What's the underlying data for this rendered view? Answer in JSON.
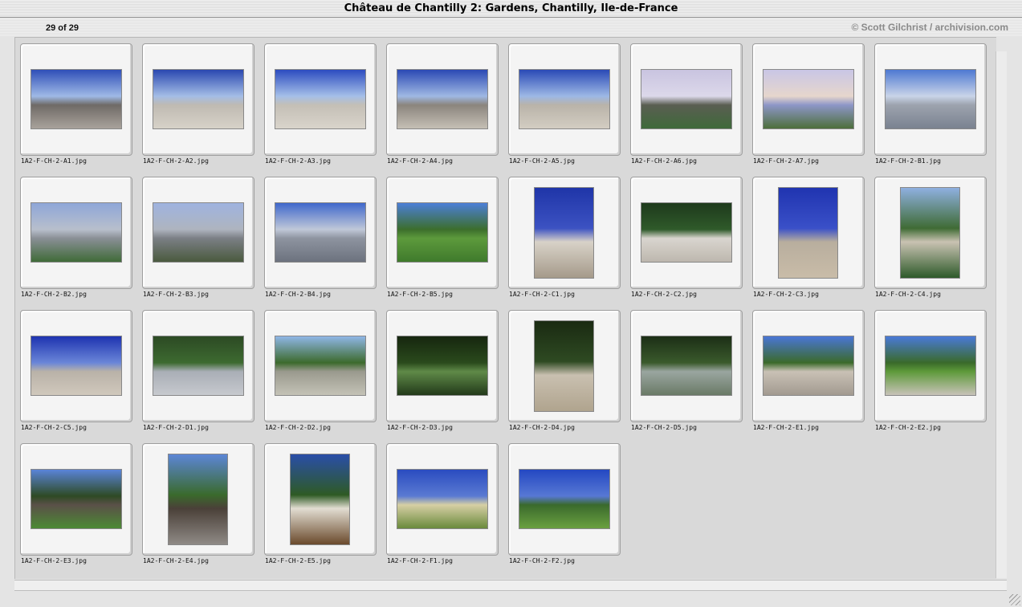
{
  "window": {
    "title": "Château de Chantilly 2: Gardens, Chantilly, Ile-de-France"
  },
  "header": {
    "counter": "29 of 29",
    "credit": "© Scott Gilchrist / archivision.com"
  },
  "thumbnails": [
    {
      "caption": "1A2-F-CH-2-A1.jpg",
      "orientation": "landscape",
      "colors": [
        "#2f4fb8",
        "#9fb9e6",
        "#6f6a66",
        "#a8a29b"
      ]
    },
    {
      "caption": "1A2-F-CH-2-A2.jpg",
      "orientation": "landscape",
      "colors": [
        "#2a48b0",
        "#a4bde6",
        "#bfbab2",
        "#d7d2c8"
      ]
    },
    {
      "caption": "1A2-F-CH-2-A3.jpg",
      "orientation": "landscape",
      "colors": [
        "#2c4cc0",
        "#a5bfe8",
        "#c4bfb6",
        "#d9d4cb"
      ]
    },
    {
      "caption": "1A2-F-CH-2-A4.jpg",
      "orientation": "landscape",
      "colors": [
        "#2b49b4",
        "#9fb8e3",
        "#8b857d",
        "#c5bfb5"
      ]
    },
    {
      "caption": "1A2-F-CH-2-A5.jpg",
      "orientation": "landscape",
      "colors": [
        "#2a4ab6",
        "#9db8e5",
        "#b9b3a9",
        "#d3cdc2"
      ]
    },
    {
      "caption": "1A2-F-CH-2-A6.jpg",
      "orientation": "landscape",
      "colors": [
        "#c9c4e0",
        "#dcd8ea",
        "#5a5e52",
        "#3f6a3a"
      ]
    },
    {
      "caption": "1A2-F-CH-2-A7.jpg",
      "orientation": "landscape",
      "colors": [
        "#c9c6e6",
        "#e6d6cc",
        "#8d96c8",
        "#4d6f3b"
      ]
    },
    {
      "caption": "1A2-F-CH-2-B1.jpg",
      "orientation": "landscape",
      "colors": [
        "#4e79d2",
        "#c9d4e8",
        "#9da3ae",
        "#7a8290"
      ]
    },
    {
      "caption": "1A2-F-CH-2-B2.jpg",
      "orientation": "landscape",
      "colors": [
        "#8ea6d8",
        "#b8bfcc",
        "#8a8f96",
        "#3f6b38"
      ]
    },
    {
      "caption": "1A2-F-CH-2-B3.jpg",
      "orientation": "landscape",
      "colors": [
        "#9fb3e0",
        "#aeb4bf",
        "#7b7f85",
        "#4a5a3e"
      ]
    },
    {
      "caption": "1A2-F-CH-2-B4.jpg",
      "orientation": "landscape",
      "colors": [
        "#3f68cc",
        "#c0c8d8",
        "#8e94a0",
        "#6c727e"
      ]
    },
    {
      "caption": "1A2-F-CH-2-B5.jpg",
      "orientation": "landscape",
      "colors": [
        "#4c7fd8",
        "#3c6e2c",
        "#5d9a3c",
        "#3f7a2c"
      ]
    },
    {
      "caption": "1A2-F-CH-2-C1.jpg",
      "orientation": "portrait",
      "colors": [
        "#1f35a8",
        "#3c52c2",
        "#d8d2c8",
        "#a59a8a"
      ]
    },
    {
      "caption": "1A2-F-CH-2-C2.jpg",
      "orientation": "landscape",
      "colors": [
        "#1e3a1c",
        "#2f5a2a",
        "#d9d5cf",
        "#bdb7ae"
      ]
    },
    {
      "caption": "1A2-F-CH-2-C3.jpg",
      "orientation": "portrait",
      "colors": [
        "#2034b0",
        "#3a50c8",
        "#b8ae9e",
        "#c9bca8"
      ]
    },
    {
      "caption": "1A2-F-CH-2-C4.jpg",
      "orientation": "portrait",
      "colors": [
        "#8fb0e0",
        "#3f6b34",
        "#c9c2b2",
        "#2e5a2a"
      ]
    },
    {
      "caption": "1A2-F-CH-2-C5.jpg",
      "orientation": "landscape",
      "colors": [
        "#1e33b0",
        "#6a86d8",
        "#b9b2a8",
        "#d0c8bc"
      ]
    },
    {
      "caption": "1A2-F-CH-2-D1.jpg",
      "orientation": "landscape",
      "colors": [
        "#2c4a24",
        "#3d6a30",
        "#a9aeb6",
        "#c6c9ce"
      ]
    },
    {
      "caption": "1A2-F-CH-2-D2.jpg",
      "orientation": "landscape",
      "colors": [
        "#8fb6e6",
        "#3c6a2c",
        "#9a9a8e",
        "#c4c2b6"
      ]
    },
    {
      "caption": "1A2-F-CH-2-D3.jpg",
      "orientation": "landscape",
      "colors": [
        "#16260f",
        "#2a4a1c",
        "#5f8a48",
        "#233a1a"
      ]
    },
    {
      "caption": "1A2-F-CH-2-D4.jpg",
      "orientation": "portrait",
      "colors": [
        "#1a2a12",
        "#2e4a22",
        "#c9c0b0",
        "#b0a48e"
      ]
    },
    {
      "caption": "1A2-F-CH-2-D5.jpg",
      "orientation": "landscape",
      "colors": [
        "#1c2e16",
        "#3a5a2c",
        "#9aa6a0",
        "#6a7a66"
      ]
    },
    {
      "caption": "1A2-F-CH-2-E1.jpg",
      "orientation": "landscape",
      "colors": [
        "#4a76d6",
        "#3b6a2a",
        "#c9c1b5",
        "#a29a90"
      ]
    },
    {
      "caption": "1A2-F-CH-2-E2.jpg",
      "orientation": "landscape",
      "colors": [
        "#4a7ad8",
        "#3a6a2a",
        "#5e9a3a",
        "#c8c2b8"
      ]
    },
    {
      "caption": "1A2-F-CH-2-E3.jpg",
      "orientation": "landscape",
      "colors": [
        "#5a84d8",
        "#2e4a24",
        "#5a5048",
        "#4c8a34"
      ]
    },
    {
      "caption": "1A2-F-CH-2-E4.jpg",
      "orientation": "portrait",
      "colors": [
        "#5c86d6",
        "#3a6a2c",
        "#4a4038",
        "#8f8a86"
      ]
    },
    {
      "caption": "1A2-F-CH-2-E5.jpg",
      "orientation": "portrait",
      "colors": [
        "#2a4ea8",
        "#2e5a24",
        "#e2ddd2",
        "#6a4a2c"
      ]
    },
    {
      "caption": "1A2-F-CH-2-F1.jpg",
      "orientation": "landscape",
      "colors": [
        "#2a4cc0",
        "#5a7ad2",
        "#d6cfa4",
        "#6a8a3c"
      ]
    },
    {
      "caption": "1A2-F-CH-2-F2.jpg",
      "orientation": "landscape",
      "colors": [
        "#2448c2",
        "#5778d4",
        "#3a6a2c",
        "#6aa040"
      ]
    }
  ]
}
